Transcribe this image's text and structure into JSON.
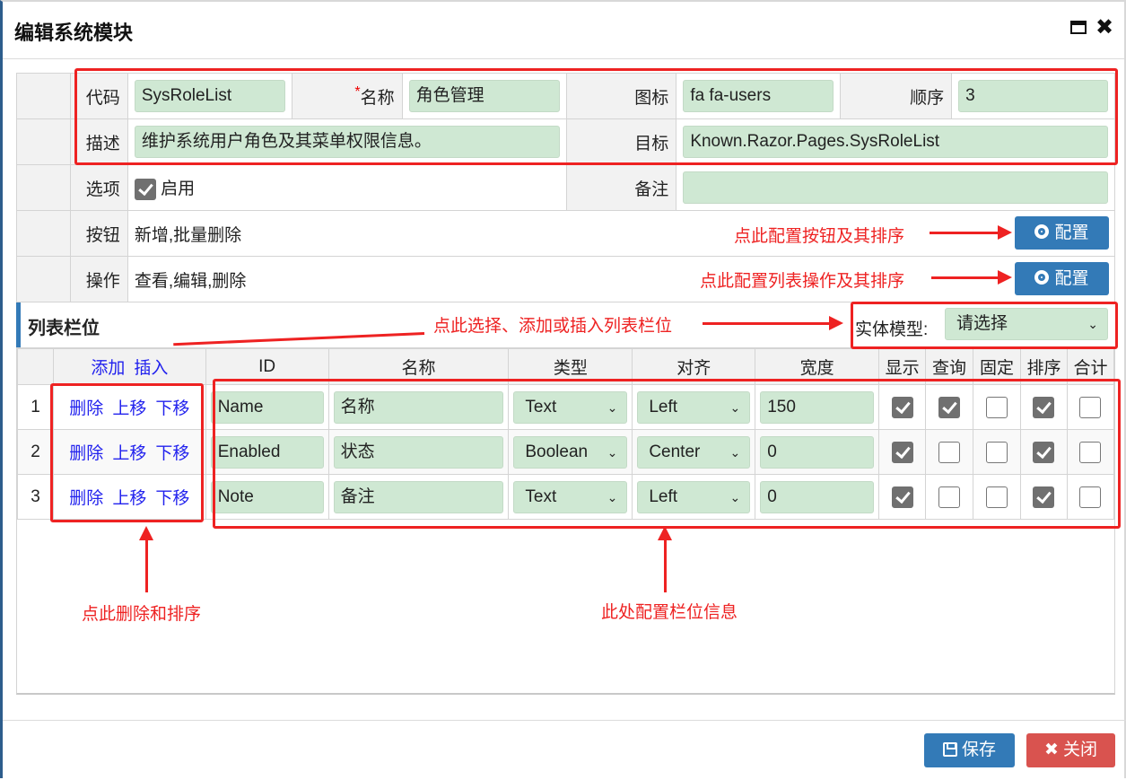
{
  "dialog": {
    "title": "编辑系统模块",
    "maximize_icon": "window-maximize-icon",
    "close_icon": "close-icon"
  },
  "form": {
    "code_label": "代码",
    "code_value": "SysRoleList",
    "name_required_mark": "*",
    "name_label": "名称",
    "name_value": "角色管理",
    "icon_label": "图标",
    "icon_value": "fa fa-users",
    "order_label": "顺序",
    "order_value": "3",
    "desc_label": "描述",
    "desc_value": "维护系统用户角色及其菜单权限信息。",
    "target_label": "目标",
    "target_value": "Known.Razor.Pages.SysRoleList",
    "options_label": "选项",
    "enabled_label": "启用",
    "enabled_checked": true,
    "note_label": "备注",
    "note_value": "",
    "buttons_label": "按钮",
    "buttons_value": "新增,批量删除",
    "actions_label": "操作",
    "actions_value": "查看,编辑,删除",
    "config_label": "配置"
  },
  "columns_section": {
    "title": "列表栏位",
    "entity_label": "实体模型:",
    "entity_selected": "请选择",
    "add_label": "添加",
    "insert_label": "插入",
    "headers": [
      "ID",
      "名称",
      "类型",
      "对齐",
      "宽度",
      "显示",
      "查询",
      "固定",
      "排序",
      "合计"
    ],
    "row_actions": {
      "delete": "删除",
      "up": "上移",
      "down": "下移"
    },
    "rows": [
      {
        "index": "1",
        "id": "Name",
        "name": "名称",
        "type": "Text",
        "align": "Left",
        "width": "150",
        "show": true,
        "query": true,
        "fixed": false,
        "sort": true,
        "sum": false
      },
      {
        "index": "2",
        "id": "Enabled",
        "name": "状态",
        "type": "Boolean",
        "align": "Center",
        "width": "0",
        "show": true,
        "query": false,
        "fixed": false,
        "sort": true,
        "sum": false
      },
      {
        "index": "3",
        "id": "Note",
        "name": "备注",
        "type": "Text",
        "align": "Left",
        "width": "0",
        "show": true,
        "query": false,
        "fixed": false,
        "sort": true,
        "sum": false
      }
    ]
  },
  "footer": {
    "save_label": "保存",
    "close_label": "关闭"
  },
  "annotations": {
    "buttons_hint": "点此配置按钮及其排序",
    "actions_hint": "点此配置列表操作及其排序",
    "columns_hint": "点此选择、添加或插入列表栏位",
    "row_ops_hint": "点此删除和排序",
    "fields_hint": "此处配置栏位信息",
    "color": "#ee2222"
  },
  "colors": {
    "primary": "#337ab7",
    "danger": "#d9534f",
    "input_bg": "#cfe8d3"
  }
}
